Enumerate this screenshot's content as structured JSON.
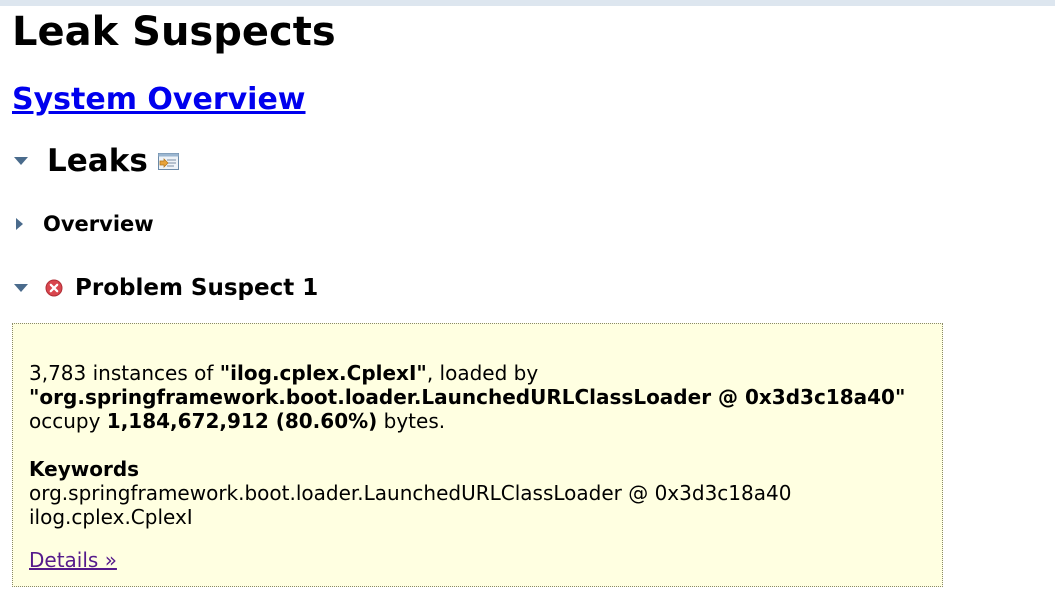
{
  "page": {
    "title": "Leak Suspects",
    "system_overview_link": "System Overview"
  },
  "leaks": {
    "heading": "Leaks",
    "icon": "report-details-icon"
  },
  "overview": {
    "label": "Overview"
  },
  "problem_suspect": {
    "heading": "Problem Suspect 1",
    "icon": "error-icon",
    "instance_count": "3,783",
    "instances_of_text": " instances of ",
    "class_name": "\"ilog.cplex.CplexI\"",
    "loaded_by_text": ", loaded by",
    "class_loader": "\"org.springframework.boot.loader.LaunchedURLClassLoader @ 0x3d3c18a40\"",
    "occupy_text": "occupy ",
    "bytes_value": "1,184,672,912 (80.60%)",
    "bytes_suffix": " bytes.",
    "keywords_title": "Keywords",
    "keywords": [
      "org.springframework.boot.loader.LaunchedURLClassLoader @ 0x3d3c18a40",
      "ilog.cplex.CplexI"
    ],
    "details_link": "Details »"
  },
  "colors": {
    "link": "#0000ee",
    "visited_link": "#551a8b",
    "suspect_background": "#ffffe1",
    "twisty": "#4a6b8c",
    "error_icon": "#d9464e"
  }
}
